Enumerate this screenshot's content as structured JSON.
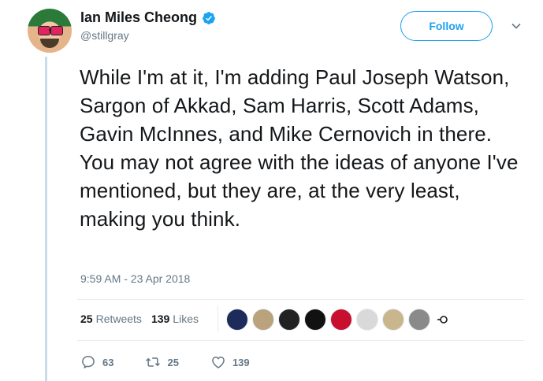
{
  "tweet": {
    "author_name": "Ian Miles Cheong",
    "author_handle": "@stillgray",
    "text": "While I'm at it, I'm adding Paul Joseph Watson, Sargon of Akkad, Sam Harris, Scott Adams, Gavin McInnes, and Mike Cernovich in there. You may not agree with the ideas of anyone I've mentioned, but they are, at the very least, making you think.",
    "timestamp": "9:59 AM - 23 Apr 2018"
  },
  "header": {
    "follow_label": "Follow"
  },
  "stats": {
    "retweets_count": "25",
    "retweets_label": "Retweets",
    "likes_count": "139",
    "likes_label": "Likes"
  },
  "likers": [
    {
      "color": "#1d2b5a"
    },
    {
      "color": "#b9a27c"
    },
    {
      "color": "#222222"
    },
    {
      "color": "#111111"
    },
    {
      "color": "#c8102e"
    },
    {
      "color": "#d9d9d9"
    },
    {
      "color": "#c9b68c"
    },
    {
      "color": "#8a8a8a"
    }
  ],
  "actions": {
    "reply_count": "63",
    "retweet_count": "25",
    "like_count": "139"
  },
  "colors": {
    "accent": "#1da1f2",
    "secondary_text": "#657786"
  }
}
